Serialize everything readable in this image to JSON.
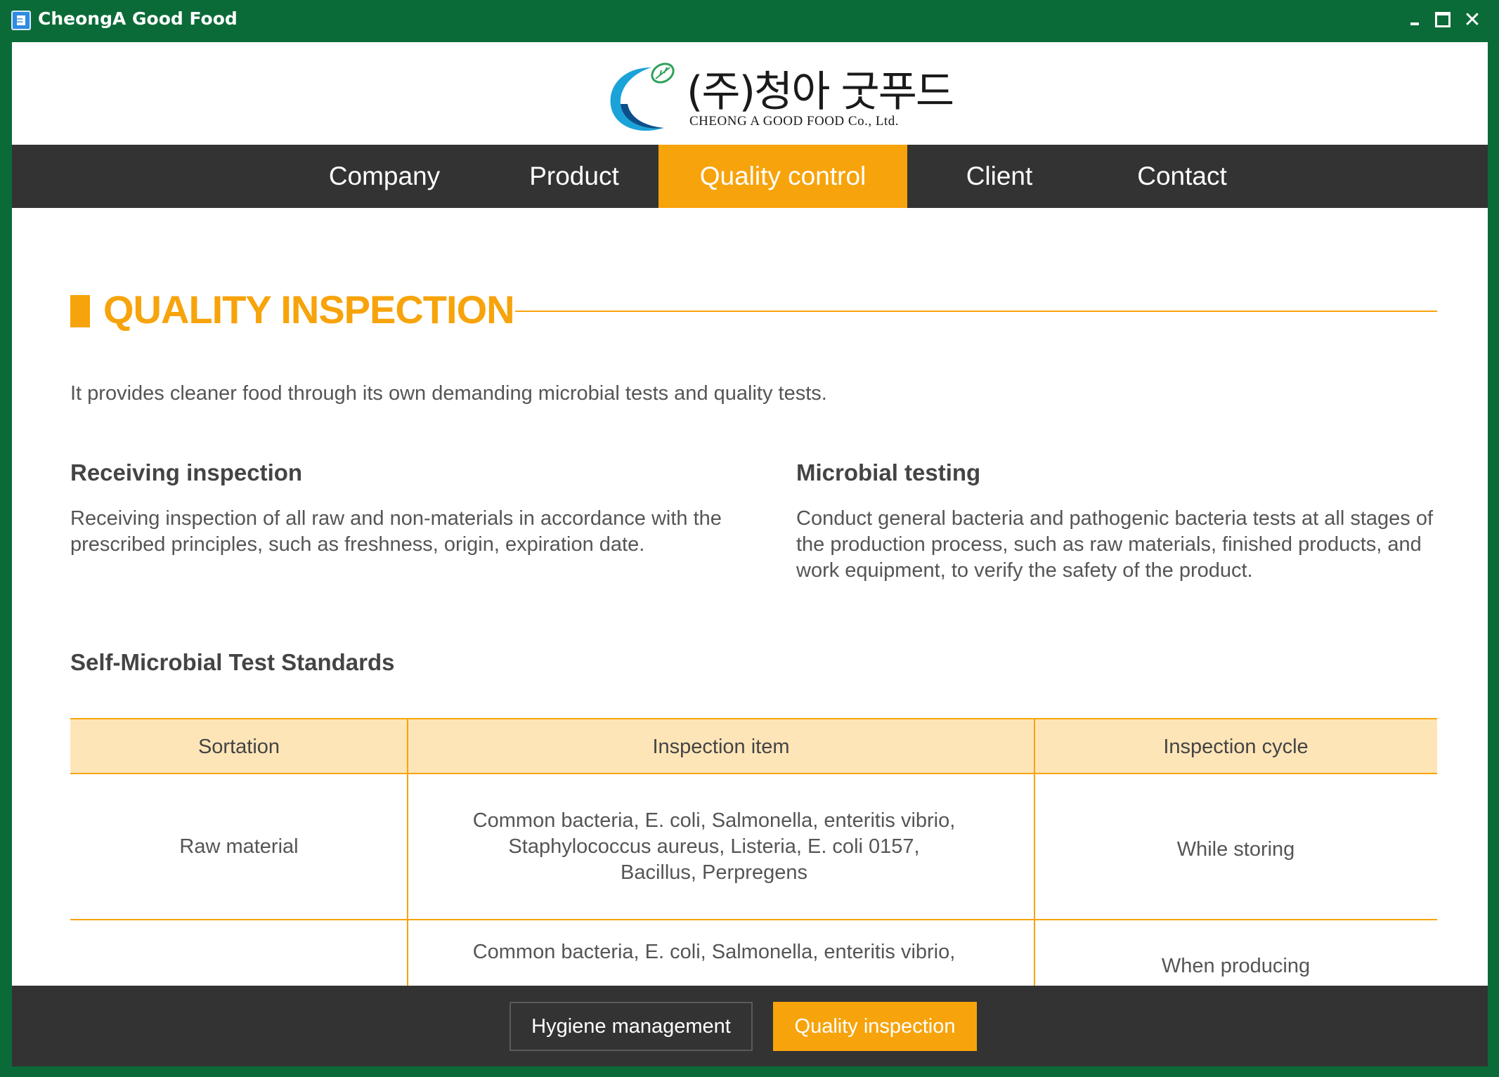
{
  "window": {
    "title": "CheongA Good Food",
    "controls": {
      "minimize": "minimize",
      "maximize": "maximize",
      "close": "✕"
    }
  },
  "logo": {
    "korean": "(주)청아 굿푸드",
    "english": "CHEONG A GOOD FOOD Co., Ltd."
  },
  "nav": {
    "items": [
      {
        "label": "Company"
      },
      {
        "label": "Product"
      },
      {
        "label": "Quality control",
        "active": true
      },
      {
        "label": "Client"
      },
      {
        "label": "Contact"
      }
    ]
  },
  "main": {
    "title": "QUALITY INSPECTION",
    "intro": "It provides cleaner food through its own demanding microbial tests and quality tests.",
    "receiving": {
      "heading": "Receiving inspection",
      "body": "Receiving inspection of all raw and non-materials in accordance with the prescribed principles, such as freshness, origin, expiration date."
    },
    "microbial": {
      "heading": "Microbial testing",
      "body": "Conduct general bacteria and pathogenic bacteria tests at all stages of the production process, such as raw materials, finished products, and work equipment, to verify the safety of the product."
    },
    "standards_heading": "Self-Microbial Test Standards",
    "table": {
      "headers": [
        "Sortation",
        "Inspection item",
        "Inspection cycle"
      ],
      "rows": [
        {
          "sortation": "Raw material",
          "item": "Common bacteria, E. coli, Salmonella, enteritis vibrio,\nStaphylococcus aureus, Listeria, E. coli 0157,\nBacillus, Perpregens",
          "cycle": "While storing"
        },
        {
          "sortation": "",
          "item": "Common bacteria, E. coli, Salmonella, enteritis vibrio,",
          "cycle": "When producing"
        }
      ]
    }
  },
  "bottom_tabs": {
    "hygiene": "Hygiene management",
    "quality": "Quality inspection"
  },
  "colors": {
    "accent": "#f7a30b",
    "window_frame": "#0b6b38",
    "nav_bg": "#333333",
    "table_header_bg": "#fde5b8"
  }
}
